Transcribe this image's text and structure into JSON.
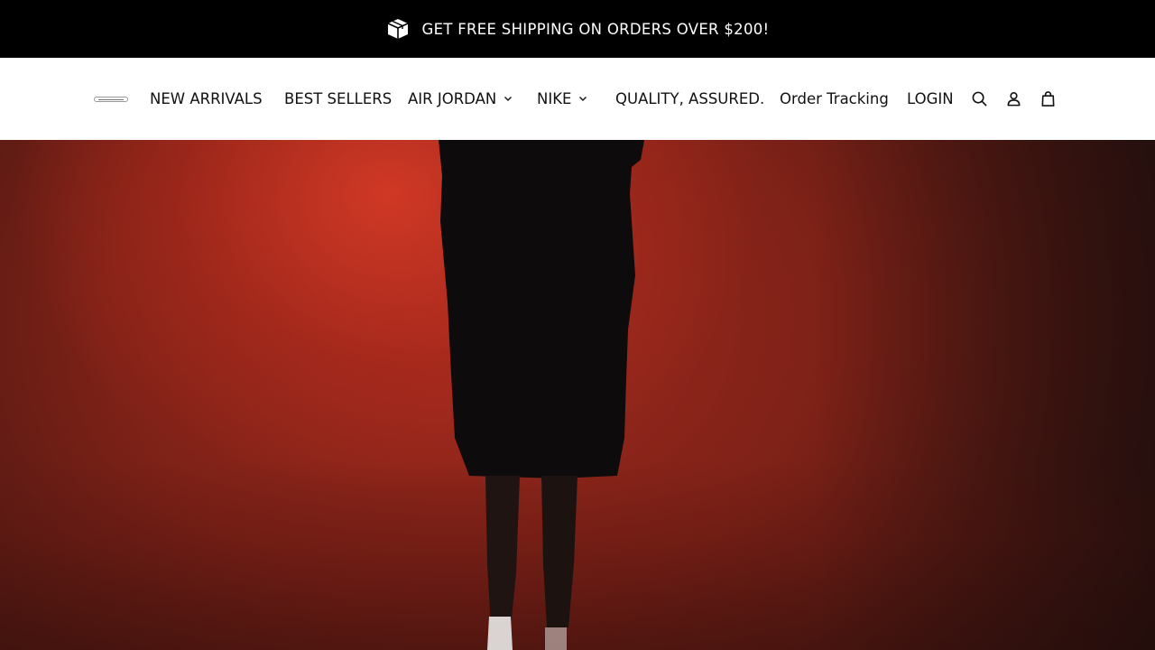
{
  "announcement": {
    "icon": "package-box-icon",
    "text": "GET FREE SHIPPING ON ORDERS OVER $200!"
  },
  "header": {
    "logo_icon": "store-logo",
    "nav": [
      {
        "label": "NEW ARRIVALS",
        "has_dropdown": false
      },
      {
        "label": "BEST SELLERS",
        "has_dropdown": false
      },
      {
        "label": "AIR JORDAN",
        "has_dropdown": true
      },
      {
        "label": "NIKE",
        "has_dropdown": true
      },
      {
        "label": "QUALITY, ASSURED.",
        "has_dropdown": false
      },
      {
        "label": "Order Tracking",
        "has_dropdown": false
      },
      {
        "label": "LOGIN",
        "has_dropdown": false
      }
    ],
    "icons": [
      "search-icon",
      "account-icon",
      "cart-bag-icon"
    ]
  },
  "hero": {
    "image": "person-in-black-shorts-red-backdrop"
  },
  "colors": {
    "announcement_bg": "#000000",
    "header_bg": "#ffffff",
    "hero_red": "#a32a1e"
  }
}
